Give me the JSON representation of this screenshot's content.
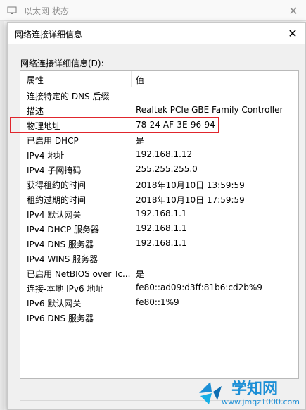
{
  "background_window": {
    "title": "以太网 状态"
  },
  "dialog": {
    "title": "网络连接详细信息",
    "list_label": "网络连接详细信息(D):",
    "columns": {
      "property": "属性",
      "value": "值"
    },
    "rows": [
      {
        "property": "连接特定的 DNS 后缀",
        "value": ""
      },
      {
        "property": "描述",
        "value": "Realtek PCIe GBE Family Controller"
      },
      {
        "property": "物理地址",
        "value": "78-24-AF-3E-96-94"
      },
      {
        "property": "已启用 DHCP",
        "value": "是"
      },
      {
        "property": "IPv4 地址",
        "value": "192.168.1.12"
      },
      {
        "property": "IPv4 子网掩码",
        "value": "255.255.255.0"
      },
      {
        "property": "获得租约的时间",
        "value": "2018年10月10日 13:59:59"
      },
      {
        "property": "租约过期的时间",
        "value": "2018年10月10日 17:59:59"
      },
      {
        "property": "IPv4 默认网关",
        "value": "192.168.1.1"
      },
      {
        "property": "IPv4 DHCP 服务器",
        "value": "192.168.1.1"
      },
      {
        "property": "IPv4 DNS 服务器",
        "value": "192.168.1.1"
      },
      {
        "property": "IPv4 WINS 服务器",
        "value": ""
      },
      {
        "property": "已启用 NetBIOS over Tc...",
        "value": "是"
      },
      {
        "property": "连接-本地 IPv6 地址",
        "value": "fe80::ad09:d3ff:81b6:cd2b%9"
      },
      {
        "property": "IPv6 默认网关",
        "value": "fe80::1%9"
      },
      {
        "property": "IPv6 DNS 服务器",
        "value": ""
      }
    ],
    "highlighted_row": "物理地址"
  },
  "watermark": {
    "title": "学知网",
    "url": "www.jmqz1000.com"
  },
  "colors": {
    "highlight": "#e0262d",
    "watermark": "#1c8fd6"
  }
}
